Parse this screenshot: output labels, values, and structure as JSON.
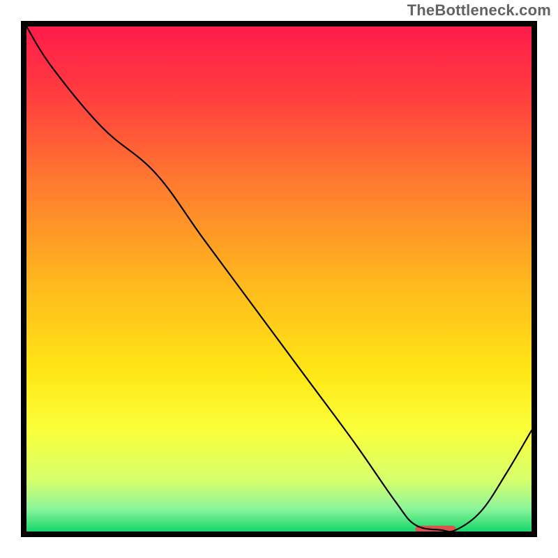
{
  "watermark": "TheBottleneck.com",
  "chart_data": {
    "type": "line",
    "title": "",
    "xlabel": "",
    "ylabel": "",
    "xlim": [
      0,
      100
    ],
    "ylim": [
      0,
      100
    ],
    "background_gradient": {
      "stops": [
        {
          "offset": 0.0,
          "color": "#ff1b4b"
        },
        {
          "offset": 0.14,
          "color": "#ff3e3e"
        },
        {
          "offset": 0.3,
          "color": "#ff7730"
        },
        {
          "offset": 0.5,
          "color": "#ffb61e"
        },
        {
          "offset": 0.68,
          "color": "#ffe615"
        },
        {
          "offset": 0.8,
          "color": "#faff3a"
        },
        {
          "offset": 0.9,
          "color": "#d6ff6e"
        },
        {
          "offset": 0.955,
          "color": "#8bf59a"
        },
        {
          "offset": 1.0,
          "color": "#17d66b"
        }
      ]
    },
    "series": [
      {
        "name": "bottleneck-curve",
        "color": "#000000",
        "width": 3,
        "x": [
          0,
          5,
          15,
          25.5,
          35,
          45,
          55,
          65,
          73,
          77,
          82,
          85,
          90,
          95,
          100
        ],
        "y": [
          100,
          92,
          80,
          71,
          58,
          44.5,
          31,
          17.5,
          6,
          1.3,
          0.3,
          0.3,
          4,
          11.5,
          20
        ]
      }
    ],
    "optimal_marker": {
      "color": "#d9544d",
      "x_start": 77,
      "x_end": 85,
      "y": 0.5,
      "thickness_pct": 1.3
    }
  }
}
